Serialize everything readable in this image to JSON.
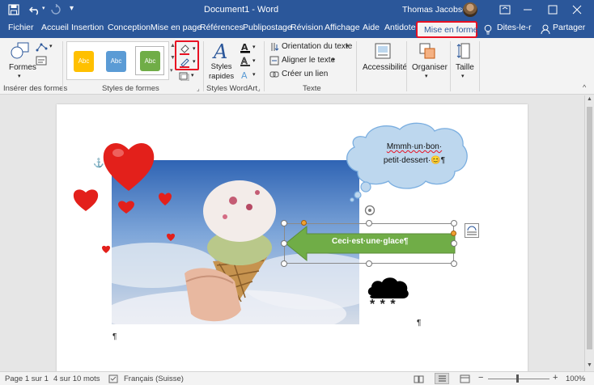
{
  "title_bar": {
    "document_title": "Document1  -  Word",
    "user_name": "Thomas Jacobsen"
  },
  "tabs": [
    {
      "label": "Fichier"
    },
    {
      "label": "Accueil"
    },
    {
      "label": "Insertion"
    },
    {
      "label": "Conception"
    },
    {
      "label": "Mise en page"
    },
    {
      "label": "Références"
    },
    {
      "label": "Publipostage"
    },
    {
      "label": "Révision"
    },
    {
      "label": "Affichage"
    },
    {
      "label": "Aide"
    },
    {
      "label": "Antidote"
    },
    {
      "label": "Mise en forme"
    }
  ],
  "tell_me": "Dites-le-r",
  "share": "Partager",
  "ribbon": {
    "insert_shapes": {
      "button": "Formes",
      "group_label": "Insérer des formes"
    },
    "shape_styles": {
      "presets": [
        "Abc",
        "Abc",
        "Abc"
      ],
      "group_label": "Styles de formes"
    },
    "wordart": {
      "quick_styles": "Styles\nrapides",
      "group_label": "Styles WordArt"
    },
    "text": {
      "orientation": "Orientation du texte",
      "align": "Aligner le texte",
      "link": "Créer un lien",
      "group_label": "Texte"
    },
    "accessibility": {
      "label": "Accessibilité"
    },
    "arrange": {
      "label": "Organiser"
    },
    "size": {
      "label": "Taille"
    }
  },
  "document": {
    "thought_bubble_line1": "Mmmh·un·bon·",
    "thought_bubble_line2": "petit·dessert·",
    "bubble_emoji": "😊",
    "pilcrow": "¶",
    "arrow_text": "Ceci·est·une·glace¶",
    "snowflakes": "* * *"
  },
  "status_bar": {
    "page": "Page 1 sur 1",
    "words": "4 sur 10 mots",
    "language": "Français (Suisse)",
    "zoom": "100%"
  },
  "colors": {
    "brand": "#2b579a",
    "highlight_red": "#e81123",
    "arrow_green": "#70ad47",
    "bubble_blue": "#bdd7ee"
  }
}
